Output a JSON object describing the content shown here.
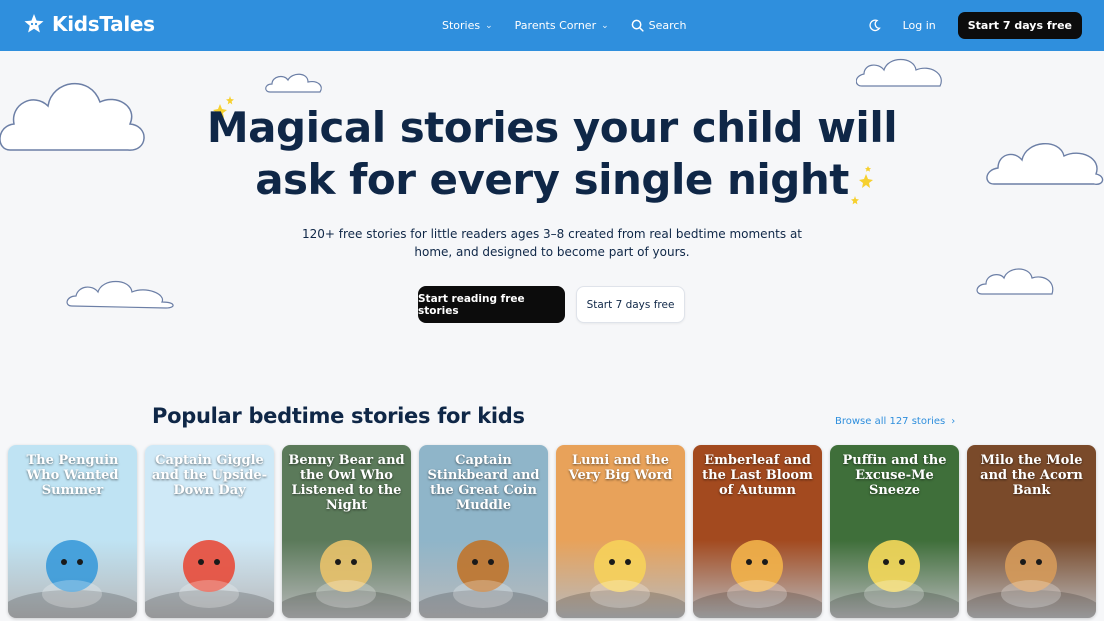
{
  "header": {
    "brand": "KidsTales",
    "nav": [
      {
        "label": "Stories",
        "has_dropdown": true
      },
      {
        "label": "Parents Corner",
        "has_dropdown": true
      },
      {
        "label": "Search",
        "icon": "search-icon"
      }
    ],
    "theme_icon": "moon-icon",
    "login_label": "Log in",
    "trial_label": "Start 7 days free"
  },
  "hero": {
    "title_line1": "Magical stories your child will",
    "title_line2": "ask for every single night",
    "subtitle": "120+ free stories for little readers ages 3–8 created from real bedtime moments at home, and designed to become part of yours.",
    "primary_cta": "Start reading free stories",
    "secondary_cta": "Start 7 days free"
  },
  "popular": {
    "title": "Popular bedtime stories for kids",
    "browse_label": "Browse all 127 stories",
    "stories": [
      {
        "title": "The Penguin Who Wanted Summer",
        "bg": "#bfe3f3",
        "accent": "#3a9ad9"
      },
      {
        "title": "Captain Giggle and the Upside-Down Day",
        "bg": "#cfe9f7",
        "accent": "#e84b3a"
      },
      {
        "title": "Benny Bear and the Owl Who Listened to the Night",
        "bg": "#5b7a5a",
        "accent": "#e9c26a"
      },
      {
        "title": "Captain Stinkbeard and the Great Coin Muddle",
        "bg": "#8fb5c9",
        "accent": "#c0742b"
      },
      {
        "title": "Lumi and the Very Big Word",
        "bg": "#e8a25a",
        "accent": "#f6d25a"
      },
      {
        "title": "Emberleaf and the Last Bloom of Autumn",
        "bg": "#a34a1f",
        "accent": "#f2b34a"
      },
      {
        "title": "Puffin and the Excuse-Me Sneeze",
        "bg": "#3f6f3a",
        "accent": "#f5d85a"
      },
      {
        "title": "Milo the Mole and the Acorn Bank",
        "bg": "#7a4a2a",
        "accent": "#d59a5a"
      }
    ]
  },
  "colors": {
    "header_bg": "#2f8fdd",
    "page_bg": "#f6f7f9",
    "heading": "#0f2747",
    "link": "#2f8fdd",
    "cta_dark": "#0c0c0c"
  }
}
